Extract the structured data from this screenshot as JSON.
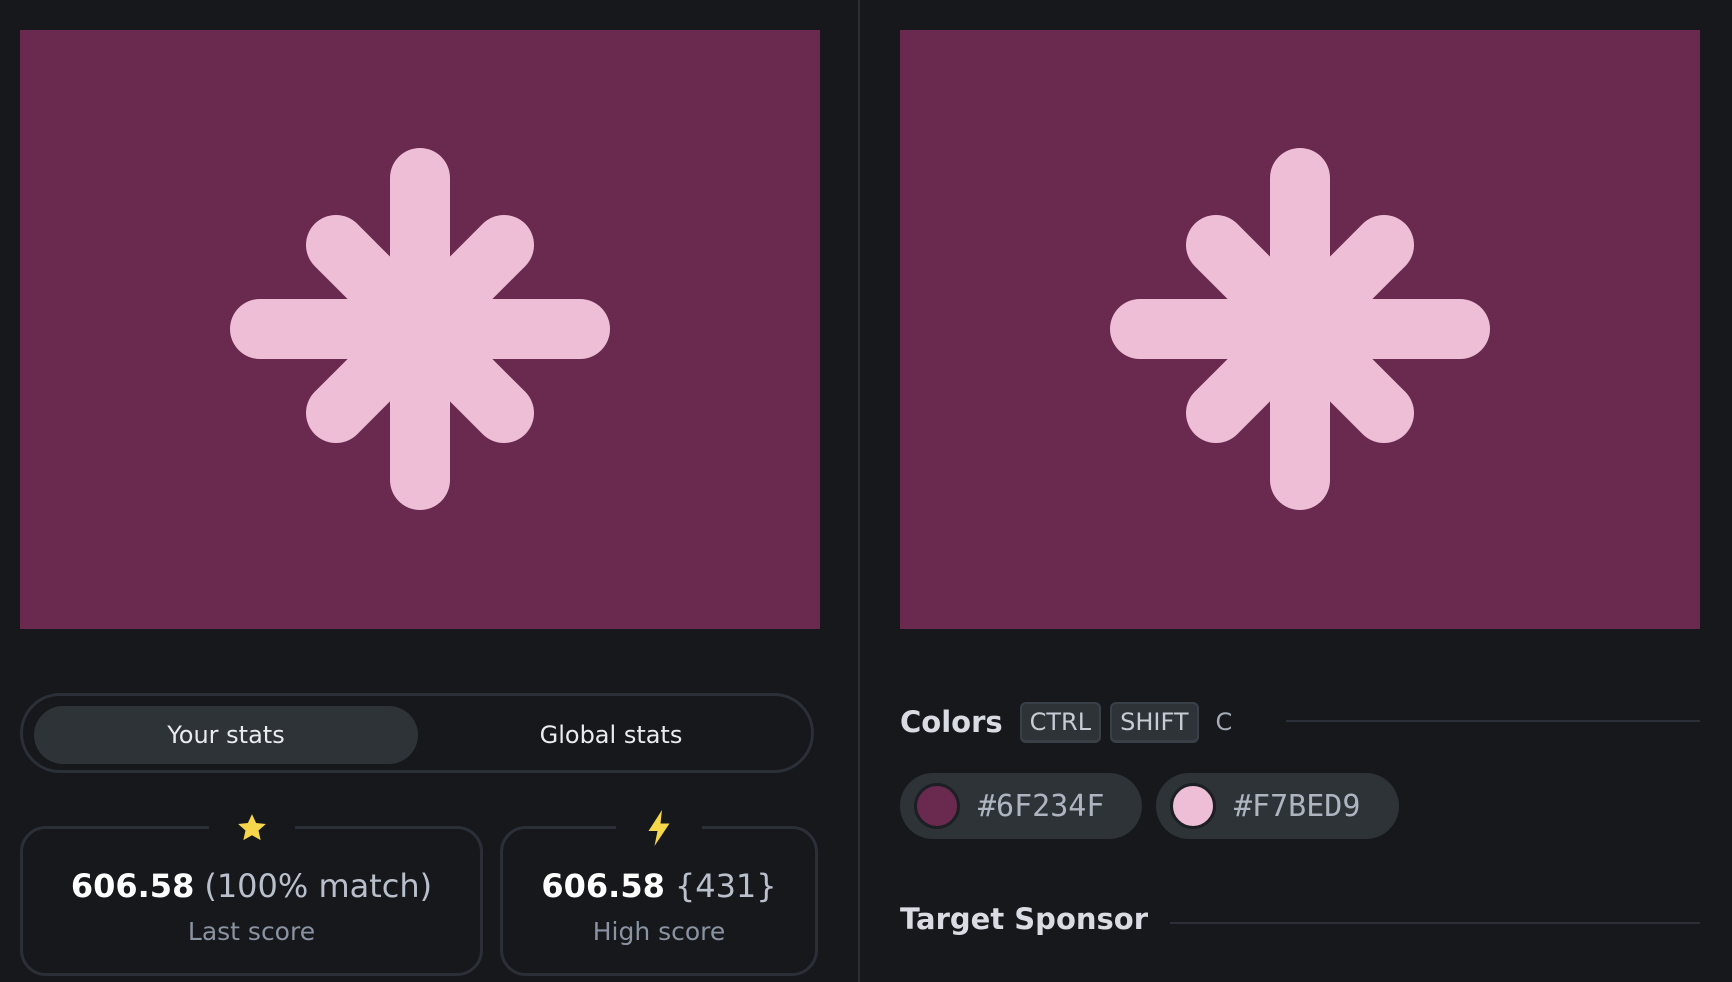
{
  "colors_hex": {
    "page_bg": "#16181c",
    "canvas_bg": "#6a2a4f",
    "shape_fill": "#edbed6",
    "star_icon": "#f6d64a",
    "bolt_icon": "#f6d64a"
  },
  "stats_toggle": {
    "your_stats": "Your stats",
    "global_stats": "Global stats",
    "active": "Your stats"
  },
  "stats": {
    "last_score": {
      "icon": "star-icon",
      "value": "606.58",
      "extra": "(100% match)",
      "label": "Last score"
    },
    "high_score": {
      "icon": "bolt-icon",
      "value": "606.58",
      "extra": "{431}",
      "label": "High score"
    }
  },
  "colors_section": {
    "title": "Colors",
    "shortcut": [
      "CTRL",
      "SHIFT",
      "C"
    ],
    "swatches": [
      {
        "label": "#6F234F",
        "color": "#6F234F"
      },
      {
        "label": "#F7BED9",
        "color": "#F7BED9"
      }
    ]
  },
  "sponsor_section": {
    "title": "Target Sponsor"
  }
}
